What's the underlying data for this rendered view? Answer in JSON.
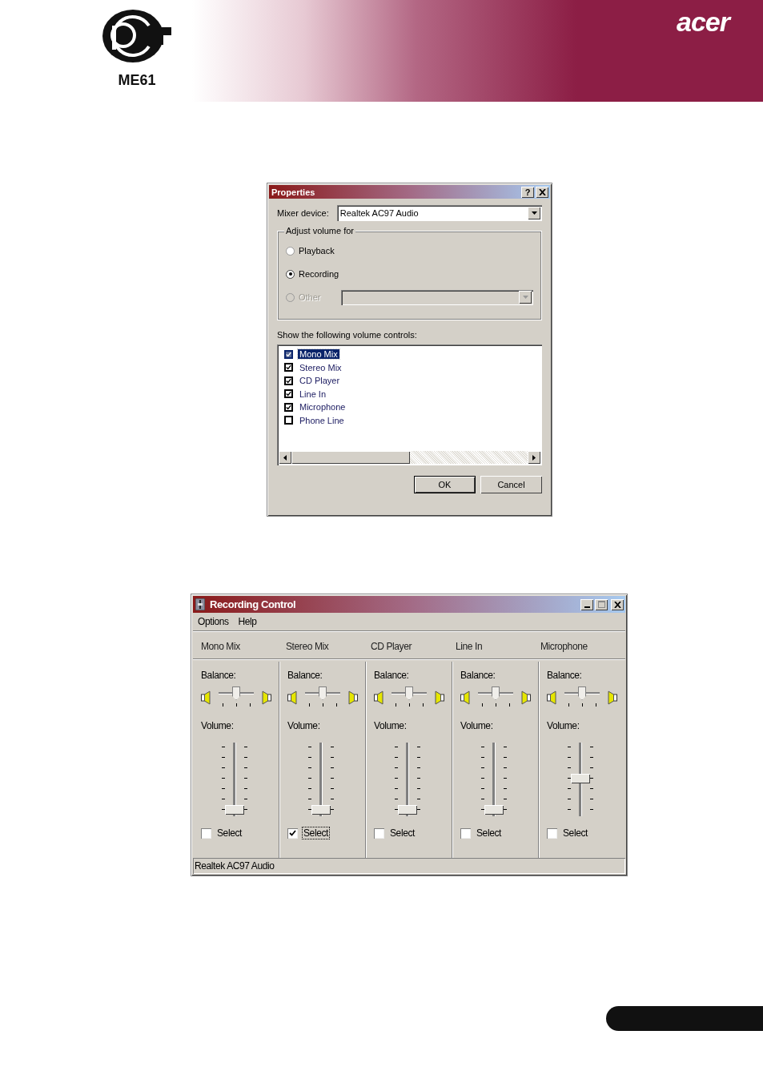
{
  "header": {
    "certification_code": "ME61",
    "brand": "acer"
  },
  "properties": {
    "title": "Properties",
    "help_button": "?",
    "mixer_label": "Mixer device:",
    "mixer_value": "Realtek AC97 Audio",
    "group_label": "Adjust volume for",
    "options": [
      {
        "label": "Playback",
        "selected": false,
        "disabled": false
      },
      {
        "label": "Recording",
        "selected": true,
        "disabled": false
      },
      {
        "label": "Other",
        "selected": false,
        "disabled": true
      }
    ],
    "list_label": "Show the following volume controls:",
    "controls": [
      {
        "label": "Mono Mix",
        "checked": true,
        "selected": true
      },
      {
        "label": "Stereo Mix",
        "checked": true,
        "selected": false
      },
      {
        "label": "CD Player",
        "checked": true,
        "selected": false
      },
      {
        "label": "Line In",
        "checked": true,
        "selected": false
      },
      {
        "label": "Microphone",
        "checked": true,
        "selected": false
      },
      {
        "label": "Phone Line",
        "checked": false,
        "selected": false
      }
    ],
    "buttons": [
      {
        "label": "OK",
        "default": true
      },
      {
        "label": "Cancel",
        "default": false
      }
    ]
  },
  "recording": {
    "title": "Recording Control",
    "menu": [
      "Options",
      "Help"
    ],
    "channels": [
      {
        "name": "Mono Mix",
        "balance_label": "Balance:",
        "balance": {
          "level": 0.5
        },
        "volume_label": "Volume:",
        "level": 0,
        "select_label": "Select",
        "selected": false
      },
      {
        "name": "Stereo Mix",
        "balance_label": "Balance:",
        "balance": {
          "level": 0.5
        },
        "volume_label": "Volume:",
        "level": 0,
        "select_label": "Select",
        "selected": true
      },
      {
        "name": "CD Player",
        "balance_label": "Balance:",
        "balance": {
          "level": 0.5
        },
        "volume_label": "Volume:",
        "level": 0,
        "select_label": "Select",
        "selected": false
      },
      {
        "name": "Line In",
        "balance_label": "Balance:",
        "balance": {
          "level": 0.5
        },
        "volume_label": "Volume:",
        "level": 0,
        "select_label": "Select",
        "selected": false
      },
      {
        "name": "Microphone",
        "balance_label": "Balance:",
        "balance": {
          "level": 0.5
        },
        "volume_label": "Volume:",
        "level": 0.5,
        "select_label": "Select",
        "selected": false
      }
    ],
    "status": "Realtek AC97 Audio"
  }
}
